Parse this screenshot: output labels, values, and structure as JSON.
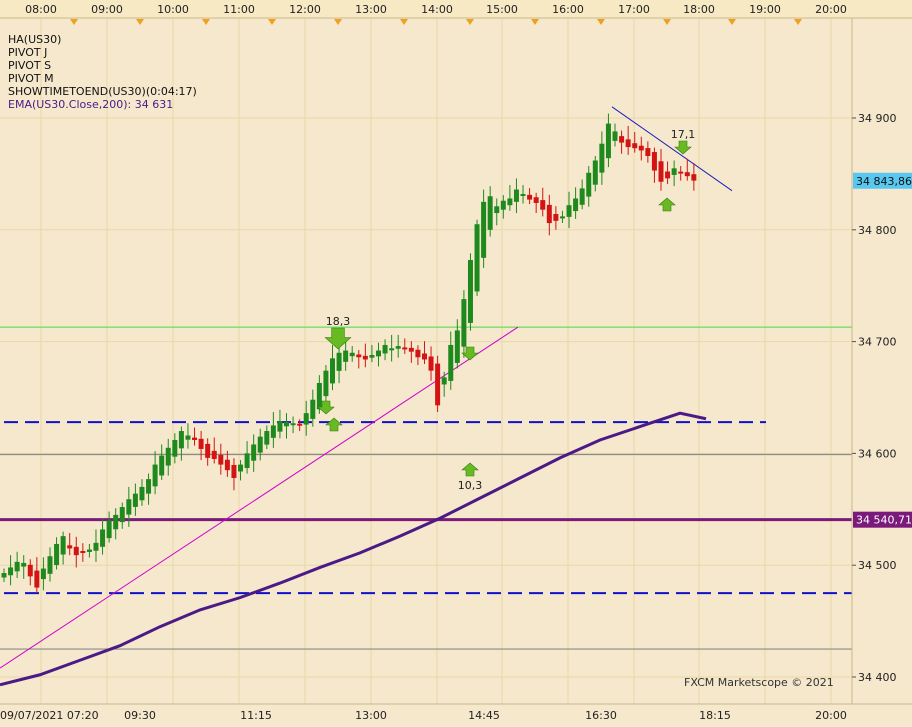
{
  "legend": {
    "lines": [
      "HA(US30)",
      "PIVOT J",
      "PIVOT S",
      "PIVOT M",
      "SHOWTIMETOEND(US30)(0:04:17)"
    ],
    "ema": "EMA(US30.Close,200): 34 631"
  },
  "watermark": "FXCM Marketscope © 2021",
  "colors": {
    "background": "#f5e8cc",
    "bull": "#1e8a1e",
    "bear": "#d41414",
    "ema": "#4b1a86",
    "pivot_blue": "#1010cc",
    "pivot_purple": "#7a1a7a",
    "support": "#44dd44",
    "trend": "#d000d0",
    "price_tag": "#58c8f0",
    "arrow": "#66bb22"
  },
  "chart_data": {
    "type": "candlestick",
    "symbol": "US30",
    "y_ticks": [
      34400,
      34500,
      34600,
      34700,
      34800,
      34900
    ],
    "y_tick_labels": [
      "34 400",
      "34 500",
      "34 600",
      "34 700",
      "34 800",
      "34 900"
    ],
    "top_time_labels": [
      "08:00",
      "09:00",
      "10:00",
      "11:00",
      "12:00",
      "13:00",
      "14:00",
      "15:00",
      "16:00",
      "17:00",
      "18:00",
      "19:00",
      "20:00"
    ],
    "bottom_time_labels": [
      "09/07/2021 07:20",
      "09:30",
      "11:15",
      "13:00",
      "14:45",
      "16:30",
      "18:15",
      "20:00"
    ],
    "last_price_label": "34 843,86",
    "pivot_label": "34 540,71",
    "levels": [
      {
        "name": "resistance",
        "value": 34713,
        "style": "green"
      },
      {
        "name": "pivot-upper",
        "value": 34628,
        "style": "blue-dashed"
      },
      {
        "name": "gray-upper",
        "value": 34599,
        "style": "gray"
      },
      {
        "name": "pivot",
        "value": 34540.71,
        "style": "purple"
      },
      {
        "name": "pivot-lower",
        "value": 34475,
        "style": "blue-dashed"
      },
      {
        "name": "gray-lower",
        "value": 34425,
        "style": "gray"
      }
    ],
    "annotations": [
      {
        "text": "18,3",
        "index": 47,
        "value": 34723,
        "arrow": "down"
      },
      {
        "text": "10,3",
        "index": 66,
        "value": 34568,
        "arrow": "up"
      },
      {
        "text": "17,1",
        "index": 96,
        "value": 34885,
        "arrow": "down"
      }
    ],
    "close_series": [
      34493,
      34498,
      34503,
      34502,
      34490,
      34480,
      34497,
      34508,
      34519,
      34526,
      34515,
      34509,
      34511,
      34514,
      34520,
      34532,
      34540,
      34545,
      34552,
      34559,
      34564,
      34570,
      34577,
      34590,
      34598,
      34605,
      34612,
      34620,
      34616,
      34612,
      34604,
      34596,
      34595,
      34590,
      34585,
      34578,
      34590,
      34600,
      34608,
      34615,
      34620,
      34625,
      34629,
      34628,
      34627,
      34625,
      34636,
      34648,
      34663,
      34674,
      34685,
      34690,
      34692,
      34690,
      34686,
      34684,
      34688,
      34692,
      34697,
      34694,
      34696,
      34694,
      34691,
      34686,
      34684,
      34674,
      34643,
      34668,
      34697,
      34710,
      34738,
      34773,
      34805,
      34825,
      34830,
      34821,
      34826,
      34828,
      34836,
      34832,
      34827,
      34824,
      34818,
      34806,
      34808,
      34812,
      34822,
      34828,
      34837,
      34851,
      34862,
      34877,
      34895,
      34888,
      34878,
      34874,
      34873,
      34871,
      34866,
      34853,
      34843,
      34846,
      34855,
      34851,
      34848,
      34844
    ],
    "ema_series": [
      [
        0,
        34393
      ],
      [
        20,
        34402
      ],
      [
        40,
        34415
      ],
      [
        60,
        34428
      ],
      [
        80,
        34445
      ],
      [
        100,
        34460
      ],
      [
        120,
        34471
      ],
      [
        140,
        34484
      ],
      [
        160,
        34498
      ],
      [
        180,
        34511
      ],
      [
        200,
        34526
      ],
      [
        220,
        34542
      ],
      [
        240,
        34560
      ],
      [
        260,
        34578
      ],
      [
        280,
        34596
      ],
      [
        300,
        34612
      ],
      [
        320,
        34624
      ],
      [
        340,
        34636
      ],
      [
        353,
        34631
      ]
    ],
    "trendlines": [
      {
        "from": [
          0,
          34408
        ],
        "to": [
          106,
          34715
        ],
        "color": "magenta"
      },
      {
        "from": [
          612,
          34910
        ],
        "to": [
          732,
          34835
        ],
        "color": "blue"
      }
    ]
  }
}
